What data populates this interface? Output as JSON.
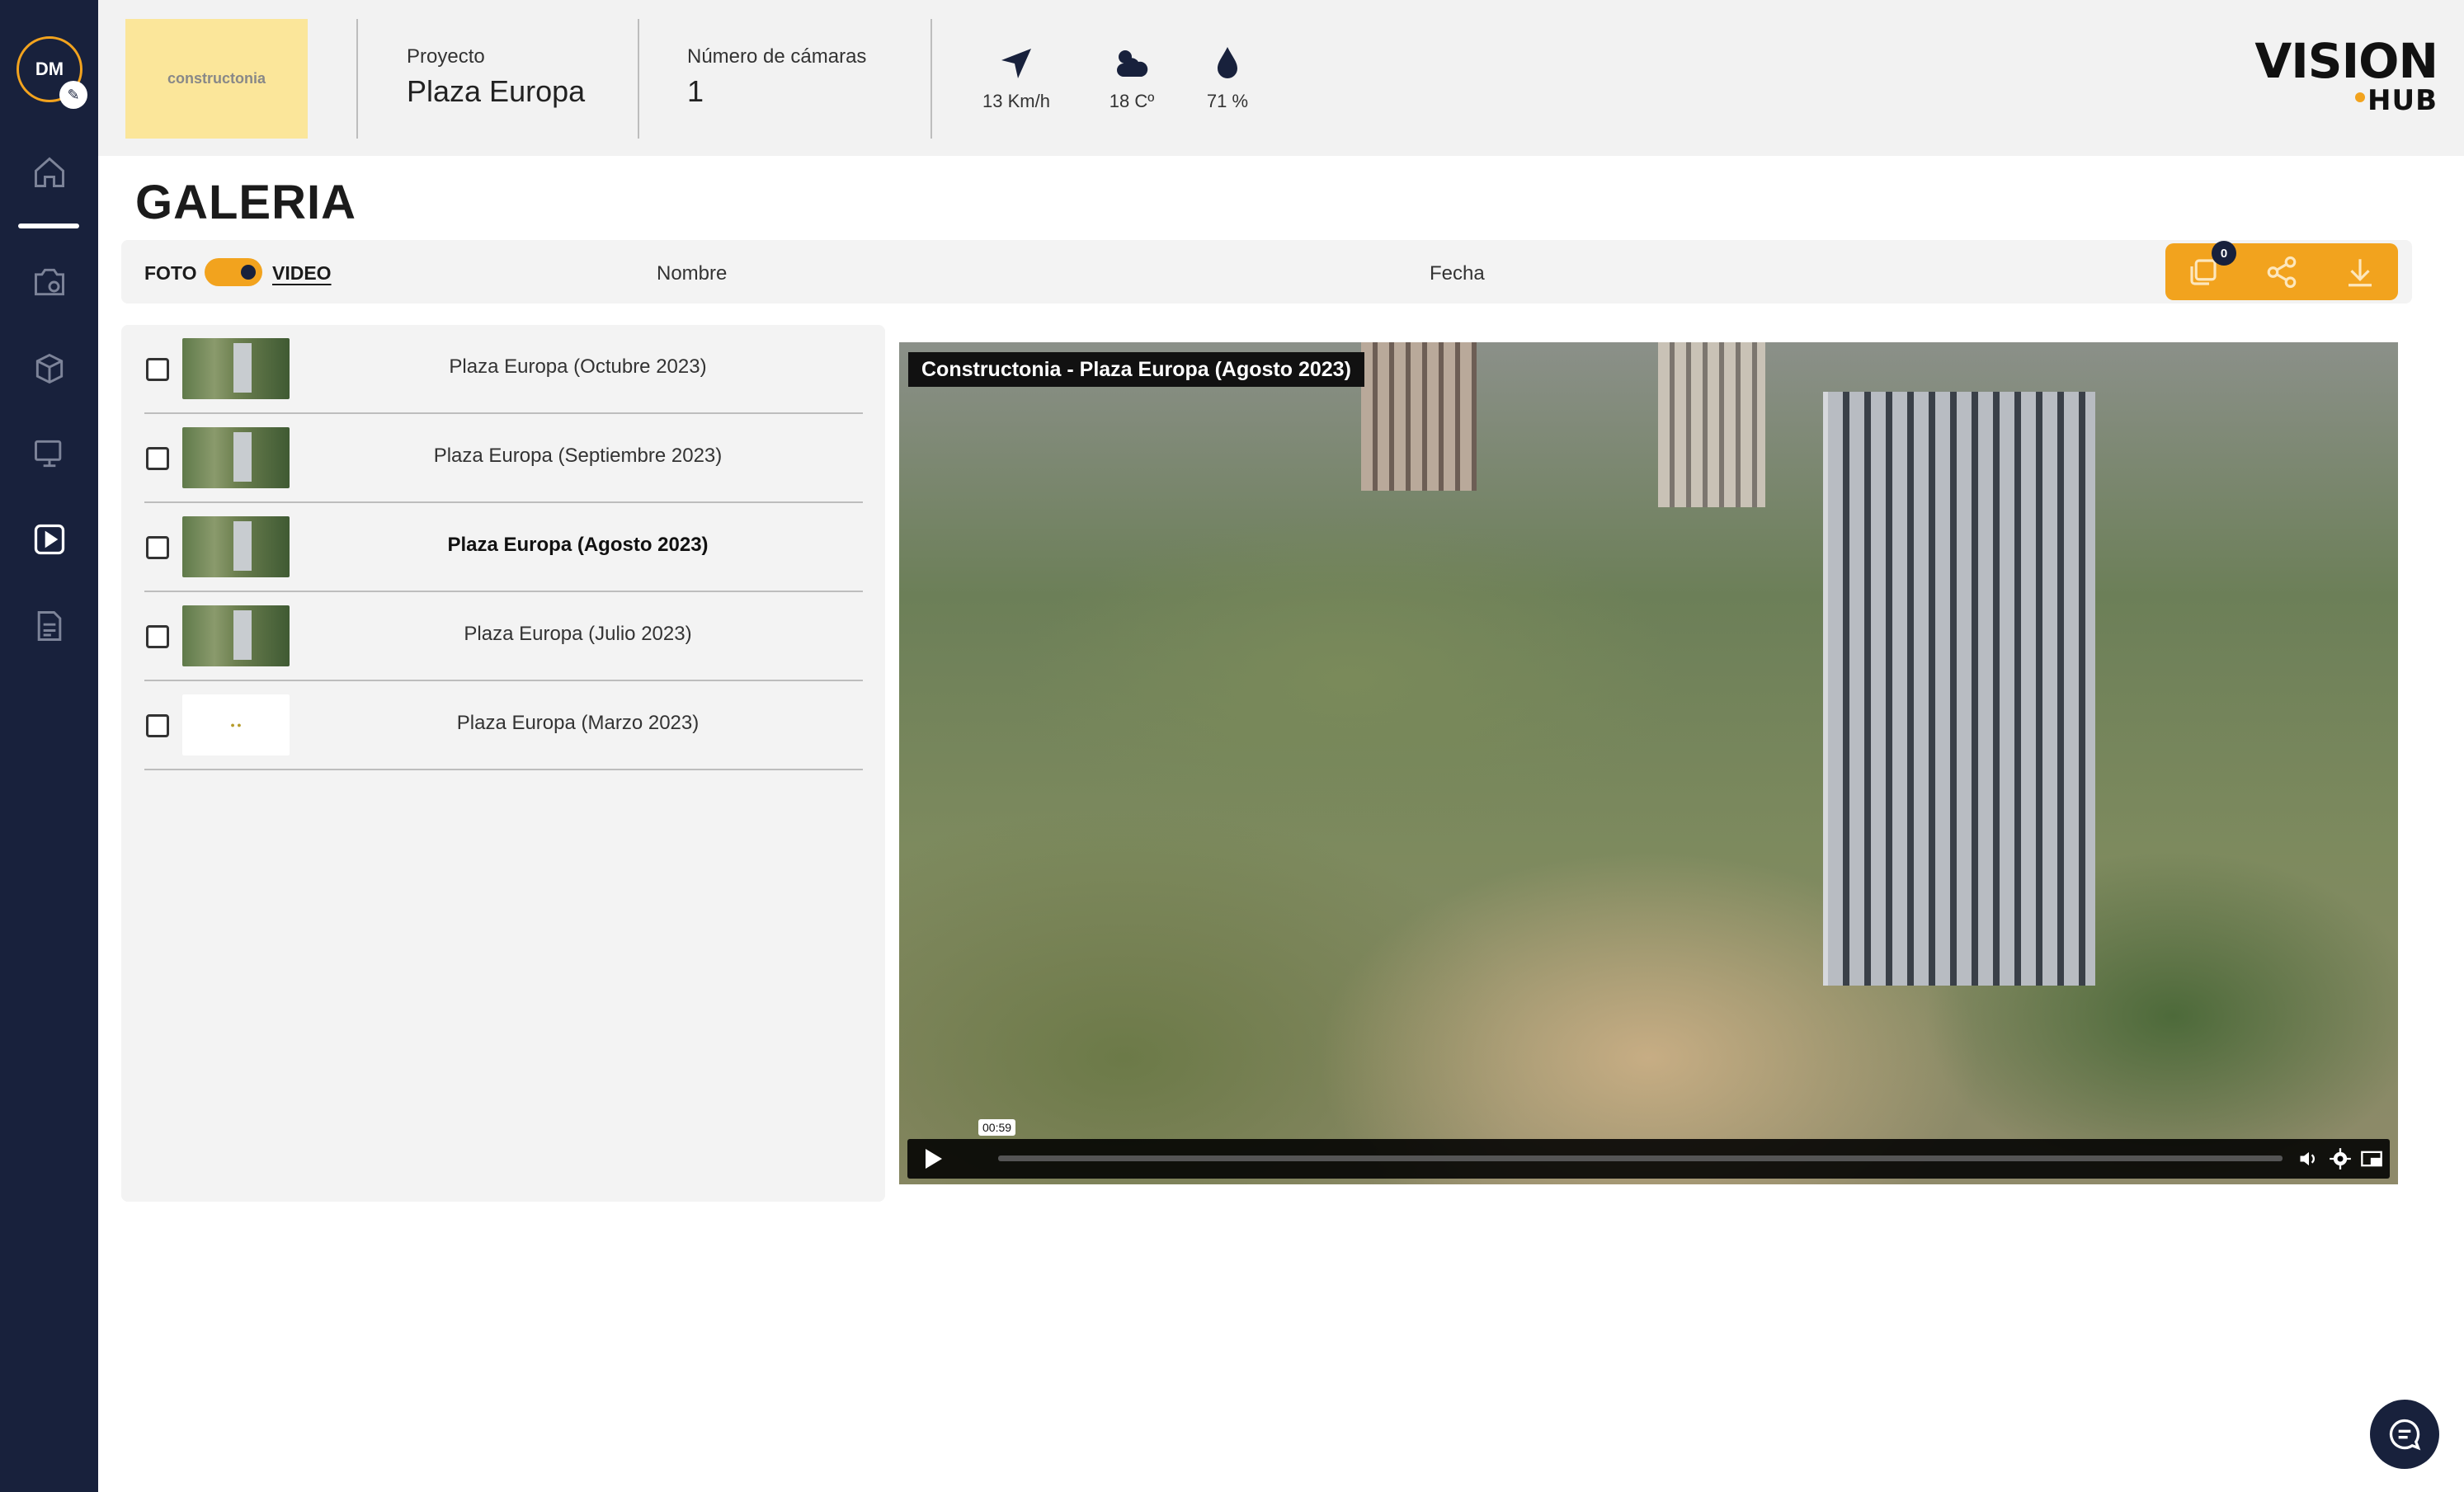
{
  "user": {
    "initials": "DM"
  },
  "sidebar": {
    "items": [
      {
        "name": "home",
        "icon": "home-icon",
        "active": false
      },
      {
        "name": "cameras",
        "icon": "camera-icon"
      },
      {
        "name": "models",
        "icon": "cube-icon"
      },
      {
        "name": "monitor",
        "icon": "monitor-icon"
      },
      {
        "name": "videos",
        "icon": "play-icon",
        "active": true
      },
      {
        "name": "reports",
        "icon": "document-icon"
      }
    ]
  },
  "header": {
    "client_logo": "constructonia",
    "project_label": "Proyecto",
    "project_value": "Plaza Europa",
    "cameras_label": "Número de cámaras",
    "cameras_value": "1",
    "weather": {
      "wind": "13 Km/h",
      "temp": "18 Cº",
      "humidity": "71 %"
    },
    "brand": "VISION HUB"
  },
  "page": {
    "title": "GALERIA"
  },
  "toolbar": {
    "foto_label": "FOTO",
    "video_label": "VIDEO",
    "mode": "VIDEO",
    "col_name": "Nombre",
    "col_date": "Fecha",
    "selected_count": "0"
  },
  "list": {
    "items": [
      {
        "label": "Plaza Europa (Octubre 2023)",
        "checked": false,
        "selected": false
      },
      {
        "label": "Plaza Europa (Septiembre 2023)",
        "checked": false,
        "selected": false
      },
      {
        "label": "Plaza Europa (Agosto 2023)",
        "checked": false,
        "selected": true
      },
      {
        "label": "Plaza Europa (Julio 2023)",
        "checked": false,
        "selected": false
      },
      {
        "label": "Plaza Europa (Marzo 2023)",
        "checked": false,
        "selected": false
      }
    ]
  },
  "player": {
    "title": "Constructonia - Plaza Europa (Agosto 2023)",
    "time_tooltip": "00:59",
    "progress": 0
  },
  "colors": {
    "accent": "#f2a31e",
    "navy": "#18213c"
  }
}
